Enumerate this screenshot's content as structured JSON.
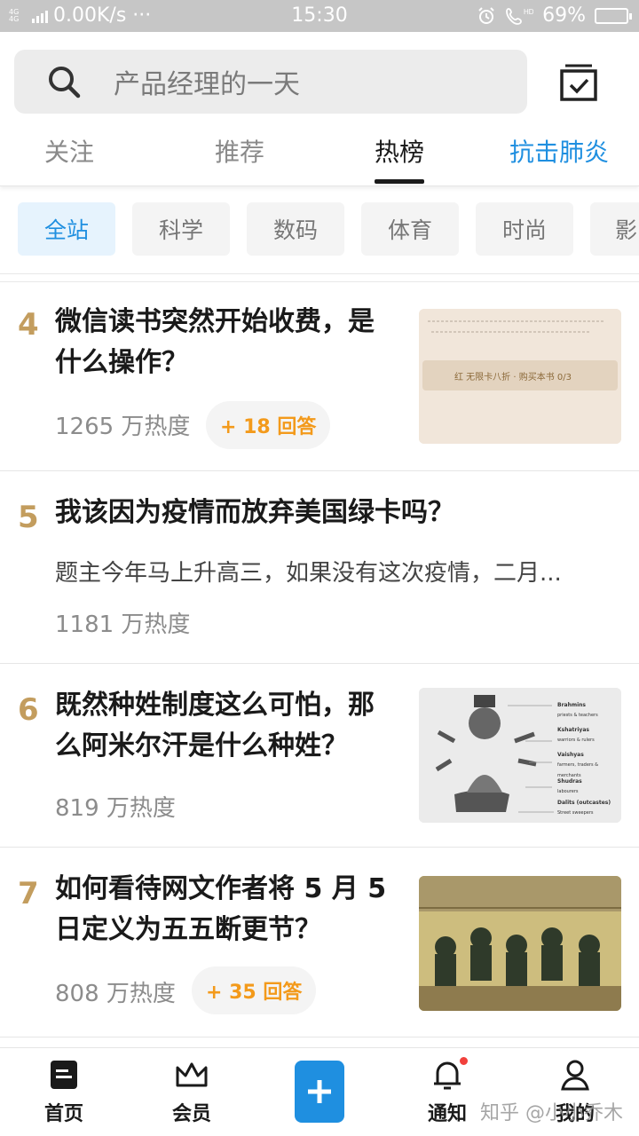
{
  "status_bar": {
    "net_tag": "4G 4G",
    "speed": "0.00K/s ···",
    "time": "15:30",
    "battery_text": "69%",
    "battery_level": 0.69
  },
  "header": {
    "search_placeholder": "产品经理的一天",
    "tabs": [
      {
        "label": "关注"
      },
      {
        "label": "推荐"
      },
      {
        "label": "热榜",
        "active": true
      },
      {
        "label": "抗击肺炎"
      }
    ]
  },
  "categories": [
    "全站",
    "科学",
    "数码",
    "体育",
    "时尚",
    "影"
  ],
  "items": [
    {
      "rank": "4",
      "title_line1": "微信读书突然开始收费，是",
      "title_line2": "什么操作？",
      "heat": "1265 万热度",
      "answers": "+ 18 回答"
    },
    {
      "rank": "5",
      "title_line1": "我该因为疫情而放弃美国绿卡吗？",
      "excerpt": "题主今年马上升高三，如果没有这次疫情，二月...",
      "heat": "1181 万热度"
    },
    {
      "rank": "6",
      "title_line1": "既然种姓制度这么可怕，那",
      "title_line2": "么阿米尔汗是什么种姓？",
      "heat": "819 万热度",
      "thumb_labels": [
        {
          "t": "Brahmins",
          "s": "priests & teachers"
        },
        {
          "t": "Kshatriyas",
          "s": "warriors & rulers"
        },
        {
          "t": "Vaishyas",
          "s": "farmers, traders & merchants"
        },
        {
          "t": "Shudras",
          "s": "labourers"
        },
        {
          "t": "Dalits (outcastes)",
          "s": "Street sweepers"
        }
      ]
    },
    {
      "rank": "7",
      "title_line1": "如何看待网文作者将 5 月 5",
      "title_line2": "日定义为五五断更节？",
      "heat": "808 万热度",
      "answers": "+ 35 回答"
    }
  ],
  "thumb1_caption": "红 无限卡八折 · 购买本书 0/3",
  "bottom_nav": {
    "home": "首页",
    "vip": "会员",
    "notify": "通知",
    "me": "我的"
  },
  "watermark": "知乎 @小小乔木"
}
